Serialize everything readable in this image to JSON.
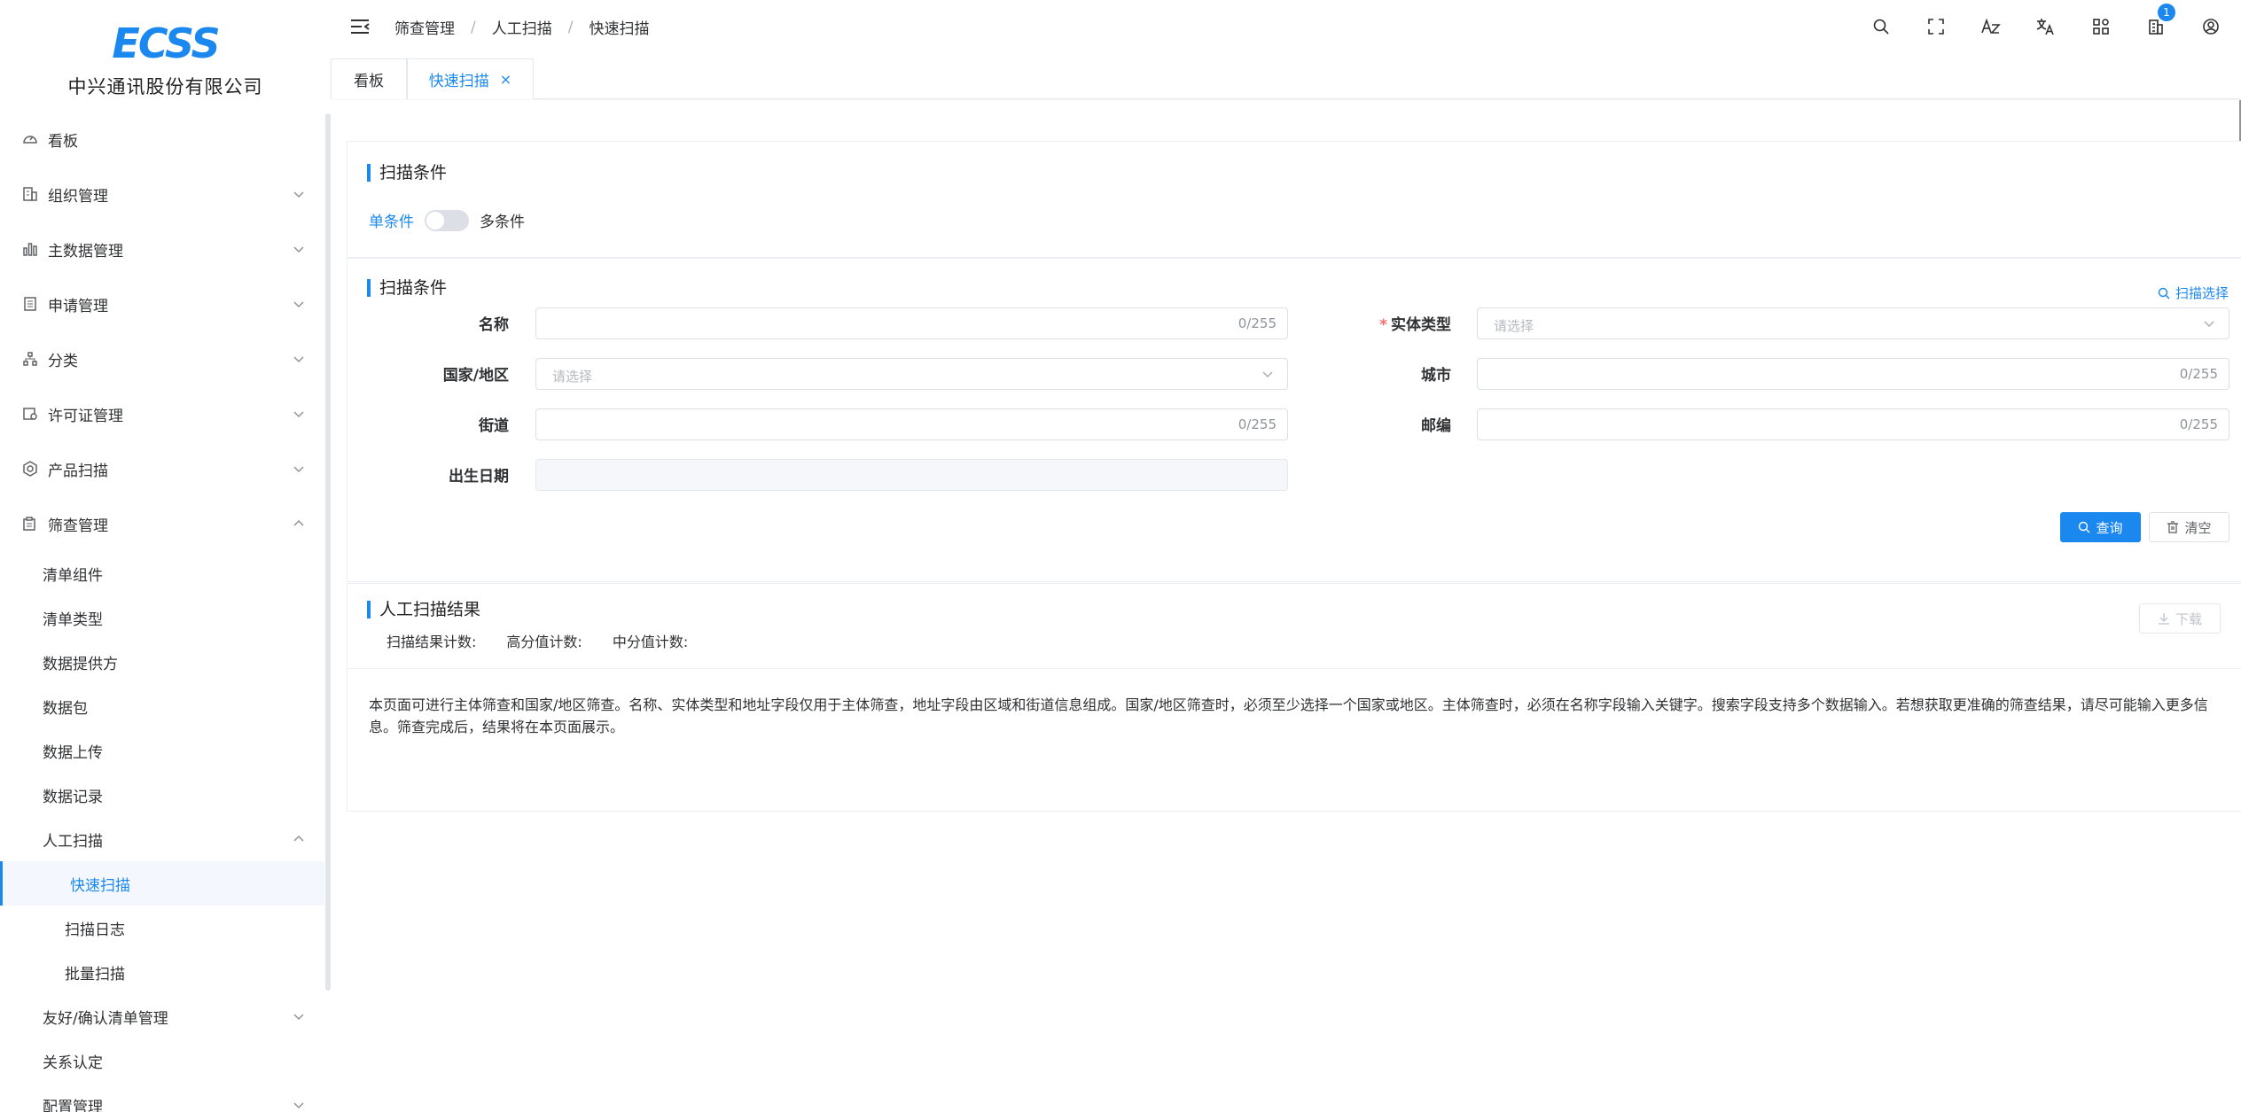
{
  "brand": {
    "logo_text": "ECSS",
    "company": "中兴通讯股份有限公司"
  },
  "sidebar": {
    "items": [
      {
        "label": "看板",
        "icon": "dashboard-icon"
      },
      {
        "label": "组织管理",
        "icon": "org-icon"
      },
      {
        "label": "主数据管理",
        "icon": "chart-icon"
      },
      {
        "label": "申请管理",
        "icon": "document-icon"
      },
      {
        "label": "分类",
        "icon": "tree-icon"
      },
      {
        "label": "许可证管理",
        "icon": "license-icon"
      },
      {
        "label": "产品扫描",
        "icon": "gear-icon"
      },
      {
        "label": "筛查管理",
        "icon": "screening-icon"
      }
    ],
    "screening_children": [
      {
        "label": "清单组件"
      },
      {
        "label": "清单类型"
      },
      {
        "label": "数据提供方"
      },
      {
        "label": "数据包"
      },
      {
        "label": "数据上传"
      },
      {
        "label": "数据记录"
      },
      {
        "label": "人工扫描"
      }
    ],
    "manual_scan_children": [
      {
        "label": "快速扫描",
        "active": true
      },
      {
        "label": "扫描日志"
      },
      {
        "label": "批量扫描"
      }
    ],
    "after_items": [
      {
        "label": "友好/确认清单管理"
      },
      {
        "label": "关系认定"
      },
      {
        "label": "配置管理"
      }
    ]
  },
  "header": {
    "breadcrumb": [
      "筛查管理",
      "人工扫描",
      "快速扫描"
    ],
    "breadcrumb_sep": "/",
    "notification_count": "1",
    "icons": [
      "search-icon",
      "fullscreen-icon",
      "font-size-icon",
      "translate-icon",
      "layout-icon",
      "building-icon",
      "user-icon"
    ]
  },
  "tabs": [
    {
      "label": "看板"
    },
    {
      "label": "快速扫描",
      "close": "×"
    }
  ],
  "scan_mode": {
    "title": "扫描条件",
    "single_label": "单条件",
    "multi_label": "多条件",
    "multi_enabled": false
  },
  "form": {
    "title": "扫描条件",
    "scan_select_label": "扫描选择",
    "name_label": "名称",
    "name_count": "0/255",
    "entity_type_label": "实体类型",
    "entity_type_required": "*",
    "entity_type_placeholder": "请选择",
    "country_label": "国家/地区",
    "country_placeholder": "请选择",
    "city_label": "城市",
    "city_count": "0/255",
    "street_label": "街道",
    "street_count": "0/255",
    "postcode_label": "邮编",
    "postcode_count": "0/255",
    "birth_label": "出生日期",
    "query_button": "查询",
    "clear_button": "清空"
  },
  "results": {
    "title": "人工扫描结果",
    "download_button": "下载",
    "count_label": "扫描结果计数:",
    "high_label": "高分值计数:",
    "mid_label": "中分值计数:",
    "description": "本页面可进行主体筛查和国家/地区筛查。名称、实体类型和地址字段仅用于主体筛查，地址字段由区域和街道信息组成。国家/地区筛查时，必须至少选择一个国家或地区。主体筛查时，必须在名称字段输入关键字。搜索字段支持多个数据输入。若想获取更准确的筛查结果，请尽可能输入更多信息。筛查完成后，结果将在本页面展示。"
  },
  "colors": {
    "accent": "#1b88f0",
    "required": "#f56c6c"
  }
}
